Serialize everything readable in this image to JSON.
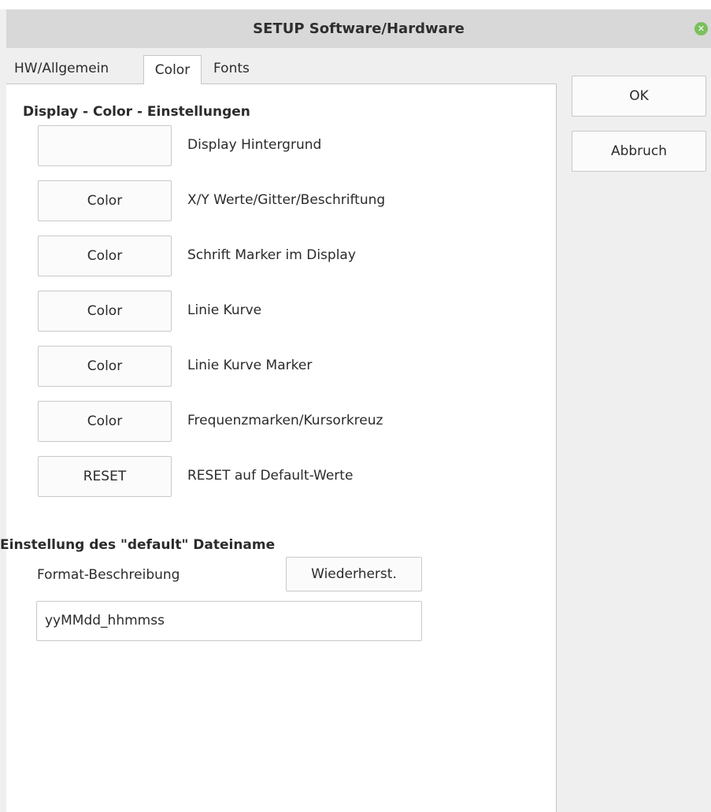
{
  "window": {
    "title": "SETUP Software/Hardware",
    "close_glyph": "✕"
  },
  "tabs": [
    {
      "label": "HW/Allgemein",
      "active": false
    },
    {
      "label": "Color",
      "active": true
    },
    {
      "label": "Fonts",
      "active": false
    }
  ],
  "color_section": {
    "title": "Display - Color - Einstellungen",
    "rows": [
      {
        "button": "",
        "label": "Display Hintergrund"
      },
      {
        "button": "Color",
        "label": "X/Y Werte/Gitter/Beschriftung"
      },
      {
        "button": "Color",
        "label": "Schrift Marker im Display"
      },
      {
        "button": "Color",
        "label": "Linie Kurve"
      },
      {
        "button": "Color",
        "label": "Linie Kurve Marker"
      },
      {
        "button": "Color",
        "label": "Frequenzmarken/Kursorkreuz"
      },
      {
        "button": "RESET",
        "label": "RESET auf Default-Werte"
      }
    ]
  },
  "filename_section": {
    "title": "Einstellung des \"default\" Dateiname",
    "field_label": "Format-Beschreibung",
    "restore_button": "Wiederherst.",
    "format_value": "yyMMdd_hhmmss"
  },
  "actions": {
    "ok": "OK",
    "cancel": "Abbruch"
  },
  "colors": {
    "titlebar": "#d8d8d8",
    "close_button": "#7bbf5e",
    "panel": "#ffffff",
    "background": "#efefef"
  }
}
